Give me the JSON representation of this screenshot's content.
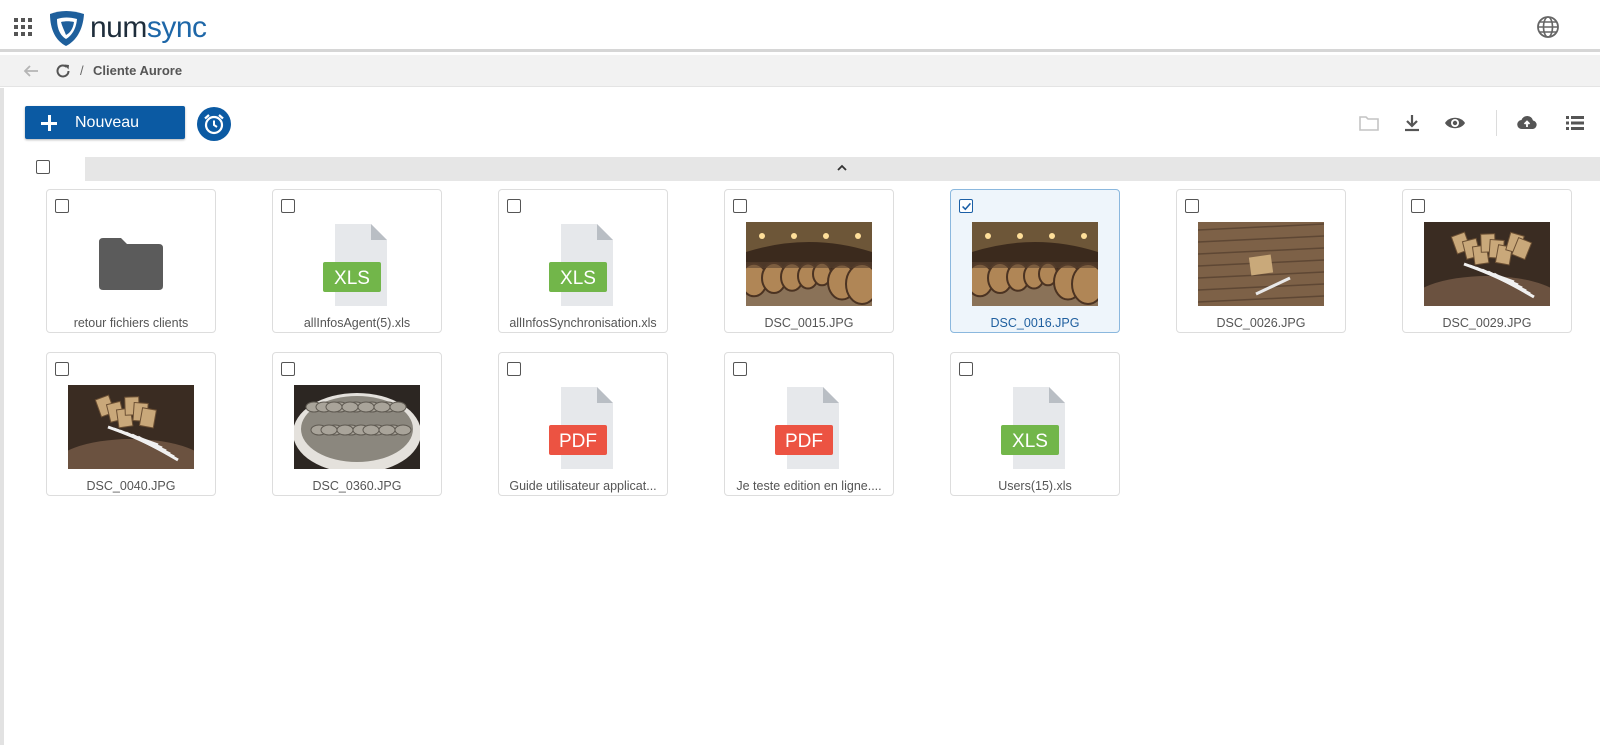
{
  "header": {
    "brand_a": "num",
    "brand_b": "sync",
    "apps_icon": "apps-grid-icon",
    "language_icon": "globe-icon"
  },
  "breadcrumb": {
    "separator": "/",
    "current": "Cliente Aurore"
  },
  "toolbar": {
    "new_label": "Nouveau",
    "icons": [
      "folder-icon",
      "download-icon",
      "eye-icon",
      "cloud-upload-icon",
      "list-view-icon"
    ]
  },
  "colors": {
    "primary": "#0b5aa3",
    "xls": "#72b64a",
    "pdf": "#ec5342",
    "folder": "#5b5b5b",
    "selected_bg": "#eef5fb"
  },
  "files": [
    {
      "name": "retour fichiers clients",
      "kind": "folder",
      "selected": false
    },
    {
      "name": "allInfosAgent(5).xls",
      "kind": "xls",
      "badge": "XLS",
      "selected": false
    },
    {
      "name": "allInfosSynchronisation.xls",
      "kind": "xls",
      "badge": "XLS",
      "selected": false
    },
    {
      "name": "DSC_0015.JPG",
      "kind": "image",
      "scene": "cellar",
      "selected": false
    },
    {
      "name": "DSC_0016.JPG",
      "kind": "image",
      "scene": "cellar",
      "selected": true
    },
    {
      "name": "DSC_0026.JPG",
      "kind": "image",
      "scene": "barrel-top",
      "selected": false
    },
    {
      "name": "DSC_0029.JPG",
      "kind": "image",
      "scene": "notebooks",
      "selected": false
    },
    {
      "name": "DSC_0040.JPG",
      "kind": "image",
      "scene": "notebooks-closeup",
      "selected": false
    },
    {
      "name": "DSC_0360.JPG",
      "kind": "image",
      "scene": "oysters",
      "selected": false
    },
    {
      "name": "Guide utilisateur applicat...",
      "kind": "pdf",
      "badge": "PDF",
      "selected": false
    },
    {
      "name": "Je teste edition en ligne....",
      "kind": "pdf",
      "badge": "PDF",
      "selected": false
    },
    {
      "name": "Users(15).xls",
      "kind": "xls",
      "badge": "XLS",
      "selected": false
    }
  ]
}
